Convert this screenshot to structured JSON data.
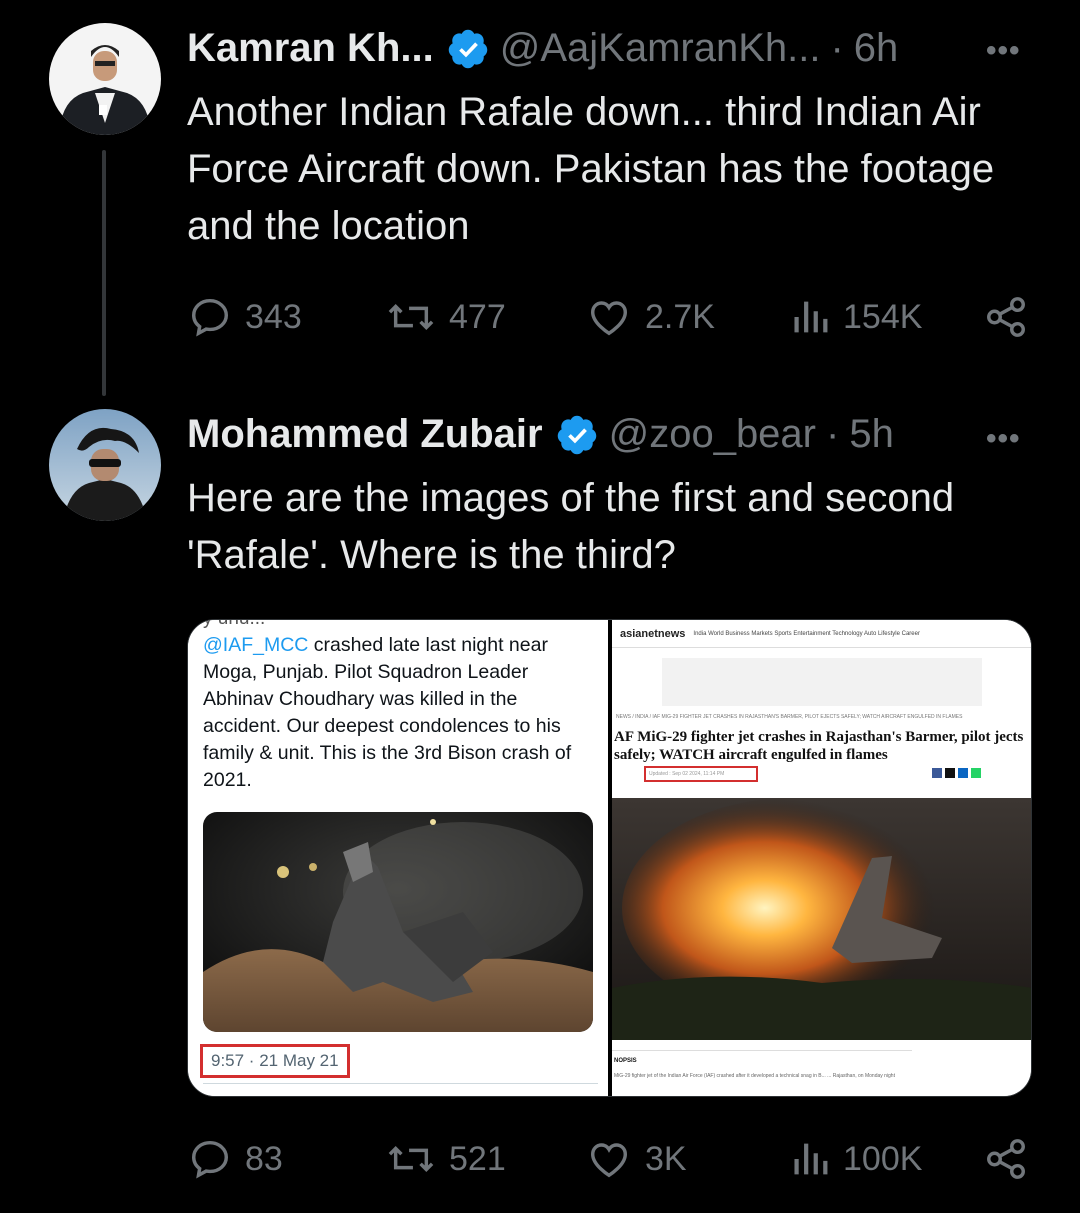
{
  "tweet1": {
    "name": "Kamran Kh...",
    "handle": "@AajKamranKh...",
    "time": "6h",
    "text": "Another Indian Rafale down... third Indian Air Force Aircraft down. Pakistan has the footage and the location",
    "stats": {
      "replies": "343",
      "reposts": "477",
      "likes": "2.7K",
      "views": "154K"
    }
  },
  "tweet2": {
    "name": "Mohammed Zubair",
    "handle": "@zoo_bear",
    "time": "5h",
    "text": "Here are the images of the first and second 'Rafale'. Where is the third?",
    "stats": {
      "replies": "83",
      "reposts": "521",
      "likes": "3K",
      "views": "100K"
    }
  },
  "media": {
    "left": {
      "cut_line": "y unu...",
      "mention": "@IAF_MCC",
      "body": " crashed late last night near Moga, Punjab. Pilot Squadron Leader Abhinav Choudhary was killed in the accident. Our deepest condolences to his family & unit. This is the 3rd Bison crash of 2021.",
      "timestamp": "9:57 · 21 May 21"
    },
    "right": {
      "site": "asianetnews",
      "nav": "India  World  Business  Markets  Sports  Entertainment  Technology  Auto  Lifestyle  Career",
      "crumb": "NEWS / INDIA / IAF MIG-29 FIGHTER JET CRASHES IN RAJASTHAN'S BARMER, PILOT EJECTS SAFELY; WATCH AIRCRAFT ENGULFED IN FLAMES",
      "headline": "AF MiG-29 fighter jet crashes in Rajasthan's Barmer, pilot jects safely; WATCH aircraft engulfed in flames",
      "updated": "Updated : Sep 02 2024, 11:14 PM",
      "synopsis_label": "NOPSIS",
      "synopsis": "MiG-29 fighter jet of the Indian Air Force (IAF) crashed after it developed a technical snag in B... ... Rajasthan, on Monday night"
    }
  },
  "colors": {
    "verified": "#1d9bf0",
    "muted": "#71767b",
    "text": "#e7e9ea",
    "highlight": "#d32f2f"
  },
  "icons": [
    "verified-badge-icon",
    "more-icon",
    "reply-icon",
    "repost-icon",
    "like-icon",
    "views-icon",
    "share-icon"
  ]
}
